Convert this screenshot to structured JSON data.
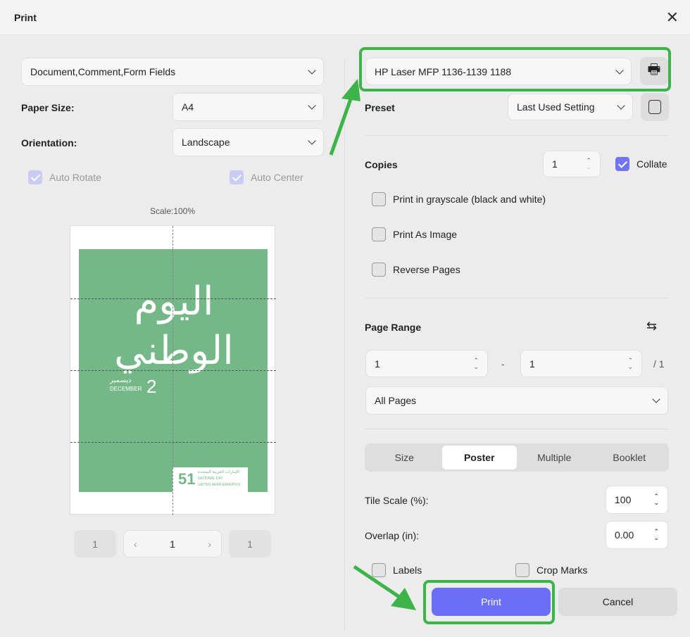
{
  "dialog": {
    "title": "Print"
  },
  "left": {
    "content_select": "Document,Comment,Form Fields",
    "paper_size_label": "Paper Size:",
    "paper_size": "A4",
    "orientation_label": "Orientation:",
    "orientation": "Landscape",
    "auto_rotate": "Auto Rotate",
    "auto_center": "Auto Center",
    "scale": "Scale:100%",
    "poster": {
      "calligraphy": "اليوم الوطني",
      "day": "2",
      "month_en": "DECEMBER",
      "month_ar": "ديسمبر",
      "badge_num": "51",
      "badge_ar": "الإمارات العربية المتحدة",
      "badge_nd": "NATIONAL DAY",
      "badge_uae": "UNITED ARAB EMIRATES"
    },
    "pager": {
      "first": "1",
      "current": "1",
      "last": "1"
    }
  },
  "right": {
    "printer": "HP Laser MFP 1136-1139 1188",
    "preset_label": "Preset",
    "preset": "Last Used Setting",
    "copies_label": "Copies",
    "copies": "1",
    "collate": "Collate",
    "grayscale": "Print in grayscale (black and white)",
    "as_image": "Print As Image",
    "reverse": "Reverse Pages",
    "page_range_label": "Page Range",
    "range_from": "1",
    "range_sep": "-",
    "range_to": "1",
    "range_total": "/ 1",
    "range_select": "All Pages",
    "tabs": [
      "Size",
      "Poster",
      "Multiple",
      "Booklet"
    ],
    "tile_scale_label": "Tile Scale (%):",
    "tile_scale": "100",
    "overlap_label": "Overlap (in):",
    "overlap": "0.00",
    "labels": "Labels",
    "crop_marks": "Crop Marks",
    "print": "Print",
    "cancel": "Cancel"
  },
  "colors": {
    "accent": "#6b6ef9",
    "highlight": "#3cb44a",
    "poster": "#74b887"
  }
}
